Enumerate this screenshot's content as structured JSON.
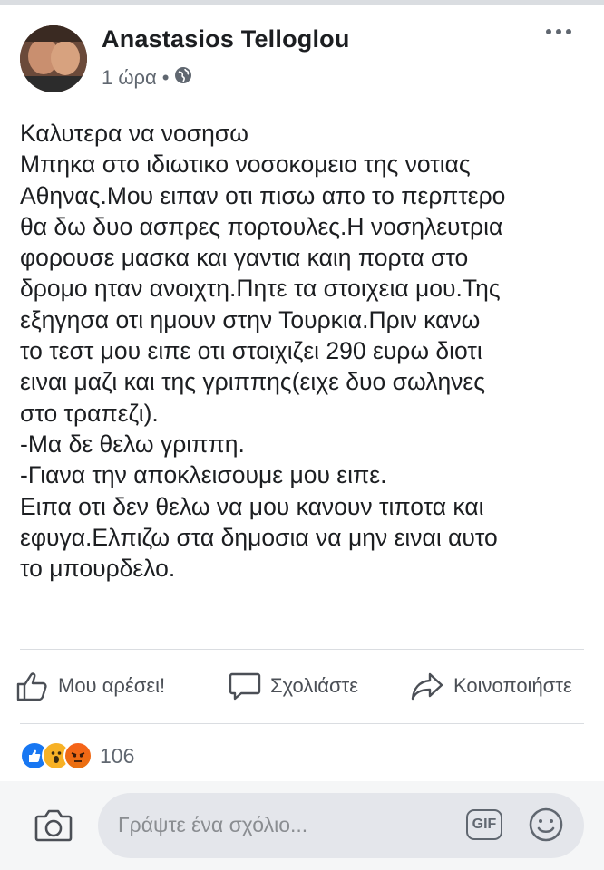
{
  "post": {
    "author": "Anastasios Telloglou",
    "time": "1 ώρα",
    "meta_separator": "•",
    "privacy_icon": "globe-icon",
    "text_lines": [
      "Καλυτερα να νοσησω",
      "Μπηκα στο ιδιωτικο νοσοκομειο της νοτιας",
      "Αθηνας.Μου ειπαν οτι πισω απο το περπτερο",
      "θα δω δυο ασπρες πορτουλες.Η νοσηλευτρια",
      "φορουσε μασκα και γαντια καιη πορτα στο",
      "δρομο ηταν ανοιχτη.Πητε τα στοιχεια μου.Της",
      "εξηγησα οτι ημουν στην Τουρκια.Πριν κανω",
      "το τεστ μου ειπε οτι στοιχιζει 290 ευρω διοτι",
      "ειναι μαζι και της γριππης(ειχε δυο σωληνες",
      "στο τραπεζι).",
      "-Μα δε θελω γριππη.",
      "-Γιανα την αποκλεισουμε μου ειπε.",
      "Ειπα οτι δεν θελω να μου κανουν τιποτα και",
      "εφυγα.Ελπιζω στα δημοσια να μην ειναι αυτο",
      "το μπουρδελο."
    ]
  },
  "actions": {
    "like": "Μου αρέσει!",
    "comment": "Σχολιάστε",
    "share": "Κοινοποιήστε"
  },
  "reactions": {
    "types": [
      "like",
      "wow",
      "angry"
    ],
    "count": "106"
  },
  "composer": {
    "placeholder": "Γράψτε ένα σχόλιο...",
    "gif_label": "GIF"
  },
  "colors": {
    "like_blue": "#1877f2",
    "wow_yellow": "#f7b125",
    "angry_orange": "#e9710f",
    "secondary_text": "#606770"
  }
}
